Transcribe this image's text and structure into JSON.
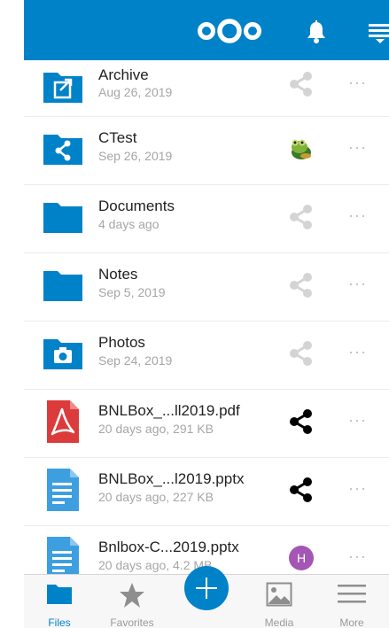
{
  "colors": {
    "brand": "#0082c9",
    "share_inactive": "#d4d4d4",
    "share_active": "#000000",
    "pdf_red": "#dc3b3b",
    "doc_blue": "#3d9fe0",
    "avatar_h": "#a456b4"
  },
  "header": {
    "logo_icon": "nextcloud-logo",
    "notifications_icon": "bell-icon",
    "menu_icon": "menu-icon"
  },
  "files": [
    {
      "name": "Archive",
      "meta": "Aug 26, 2019",
      "icon": "folder-external-icon",
      "share": "share-icon",
      "shared": false
    },
    {
      "name": "CTest",
      "meta": "Sep 26, 2019",
      "icon": "folder-shared-icon",
      "share": "frog-avatar",
      "shared": true
    },
    {
      "name": "Documents",
      "meta": "4 days ago",
      "icon": "folder-icon",
      "share": "share-icon",
      "shared": false
    },
    {
      "name": "Notes",
      "meta": "Sep 5, 2019",
      "icon": "folder-icon",
      "share": "share-icon",
      "shared": false
    },
    {
      "name": "Photos",
      "meta": "Sep 24, 2019",
      "icon": "folder-camera-icon",
      "share": "share-icon",
      "shared": false
    },
    {
      "name": "BNLBox_...ll2019.pdf",
      "meta": "20 days ago, 291 KB",
      "icon": "pdf-icon",
      "share": "share-icon",
      "shared": true
    },
    {
      "name": "BNLBox_...l2019.pptx",
      "meta": "20 days ago, 227 KB",
      "icon": "document-icon",
      "share": "share-icon",
      "shared": true
    },
    {
      "name": "Bnlbox-C...2019.pptx",
      "meta": "20 days ago, 4.2 MB",
      "icon": "document-icon",
      "share": "letter-avatar",
      "shared": true,
      "avatar_letter": "H"
    }
  ],
  "more_glyph": "···",
  "tabs": [
    {
      "label": "Files",
      "icon": "folder-icon",
      "active": true
    },
    {
      "label": "Favorites",
      "icon": "star-icon",
      "active": false
    },
    {
      "label": "",
      "icon": "plus-icon",
      "active": false
    },
    {
      "label": "Media",
      "icon": "image-icon",
      "active": false
    },
    {
      "label": "More",
      "icon": "menu-lines-icon",
      "active": false
    }
  ]
}
